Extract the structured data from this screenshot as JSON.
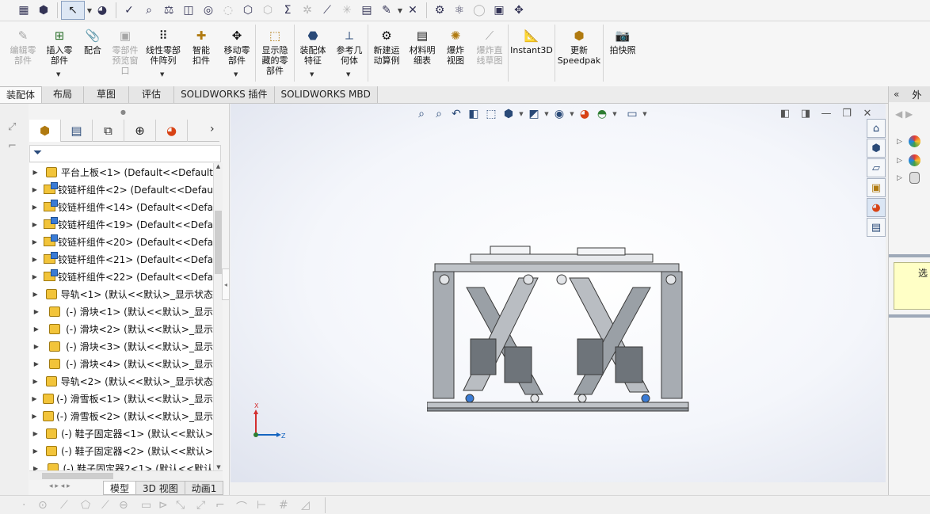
{
  "toolbar": {
    "icons": [
      "options-icon",
      "rebuild-icon",
      "select-icon",
      "appearance-icon",
      "spell-check-icon",
      "measure-icon",
      "mass-properties-icon",
      "section-icon",
      "interference-icon",
      "clearance-icon",
      "hole-alignment-icon",
      "summation-icon",
      "sensor-icon",
      "check-icon",
      "compare-icon",
      "cleanup-icon",
      "excel-icon",
      "simulation-icon",
      "toolbox-icon",
      "dimxpert-icon",
      "solidworks-plastics-icon",
      "addins-icon"
    ]
  },
  "ribbon": {
    "buttons": [
      {
        "label": "编辑零部件",
        "enabled": false,
        "icon": "edit-component-icon"
      },
      {
        "label": "插入零部件",
        "enabled": true,
        "icon": "insert-component-icon",
        "dropdown": true
      },
      {
        "label": "配合",
        "enabled": true,
        "icon": "mate-icon"
      },
      {
        "label": "零部件预览窗口",
        "enabled": false,
        "icon": "component-preview-icon"
      },
      {
        "label": "线性零部件阵列",
        "enabled": true,
        "icon": "linear-pattern-icon",
        "dropdown": true
      },
      {
        "label": "智能扣件",
        "enabled": true,
        "icon": "smart-fasteners-icon"
      },
      {
        "label": "移动零部件",
        "enabled": true,
        "icon": "move-component-icon",
        "dropdown": true
      },
      {
        "label": "显示隐藏的零部件",
        "enabled": true,
        "icon": "show-hidden-icon"
      },
      {
        "label": "装配体特征",
        "enabled": true,
        "icon": "assembly-features-icon",
        "dropdown": true
      },
      {
        "label": "参考几何体",
        "enabled": true,
        "icon": "reference-geometry-icon",
        "dropdown": true
      },
      {
        "label": "新建运动算例",
        "enabled": true,
        "icon": "motion-study-icon"
      },
      {
        "label": "材料明细表",
        "enabled": true,
        "icon": "bom-icon"
      },
      {
        "label": "爆炸视图",
        "enabled": true,
        "icon": "exploded-view-icon"
      },
      {
        "label": "爆炸直线草图",
        "enabled": false,
        "icon": "explode-line-sketch-icon"
      },
      {
        "label": "Instant3D",
        "enabled": true,
        "icon": "instant3d-icon"
      },
      {
        "label": "更新Speedpak",
        "enabled": true,
        "icon": "speedpak-icon"
      },
      {
        "label": "拍快照",
        "enabled": true,
        "icon": "snapshot-icon"
      }
    ]
  },
  "tabs": [
    "装配体",
    "布局",
    "草图",
    "评估",
    "SOLIDWORKS 插件",
    "SOLIDWORKS MBD"
  ],
  "active_tab": "装配体",
  "feature_tree": {
    "items": [
      {
        "text": "平台上板<1> (Default<<Default",
        "type": "part"
      },
      {
        "text": "铰链杆组件<2> (Default<<Defau",
        "type": "assembly"
      },
      {
        "text": "铰链杆组件<14> (Default<<Defa",
        "type": "assembly"
      },
      {
        "text": "铰链杆组件<19> (Default<<Defa",
        "type": "assembly"
      },
      {
        "text": "铰链杆组件<20> (Default<<Defa",
        "type": "assembly"
      },
      {
        "text": "铰链杆组件<21> (Default<<Defa",
        "type": "assembly"
      },
      {
        "text": "铰链杆组件<22> (Default<<Defa",
        "type": "assembly"
      },
      {
        "text": "导轨<1> (默认<<默认>_显示状态",
        "type": "part"
      },
      {
        "text": "(-) 滑块<1> (默认<<默认>_显示",
        "type": "part"
      },
      {
        "text": "(-) 滑块<2> (默认<<默认>_显示",
        "type": "part"
      },
      {
        "text": "(-) 滑块<3> (默认<<默认>_显示",
        "type": "part"
      },
      {
        "text": "(-) 滑块<4> (默认<<默认>_显示",
        "type": "part"
      },
      {
        "text": "导轨<2> (默认<<默认>_显示状态",
        "type": "part"
      },
      {
        "text": "(-) 滑雪板<1> (默认<<默认>_显示",
        "type": "part"
      },
      {
        "text": "(-) 滑雪板<2> (默认<<默认>_显示",
        "type": "part"
      },
      {
        "text": "(-) 鞋子固定器<1> (默认<<默认>",
        "type": "part"
      },
      {
        "text": "(-) 鞋子固定器<2> (默认<<默认>",
        "type": "part"
      },
      {
        "text": "(-) 鞋子固定器2<1> (默认<<默认",
        "type": "part"
      }
    ]
  },
  "model_tabs": [
    "模型",
    "3D 视图",
    "动画1"
  ],
  "active_model_tab": "模型",
  "triad": {
    "x": "X",
    "z": "Z"
  },
  "task_pane": {
    "title": "外",
    "note": "选"
  },
  "colors": {
    "accent": "#2a4a78",
    "part_yellow": "#f2c43a",
    "note_bg": "#ffffc6"
  }
}
